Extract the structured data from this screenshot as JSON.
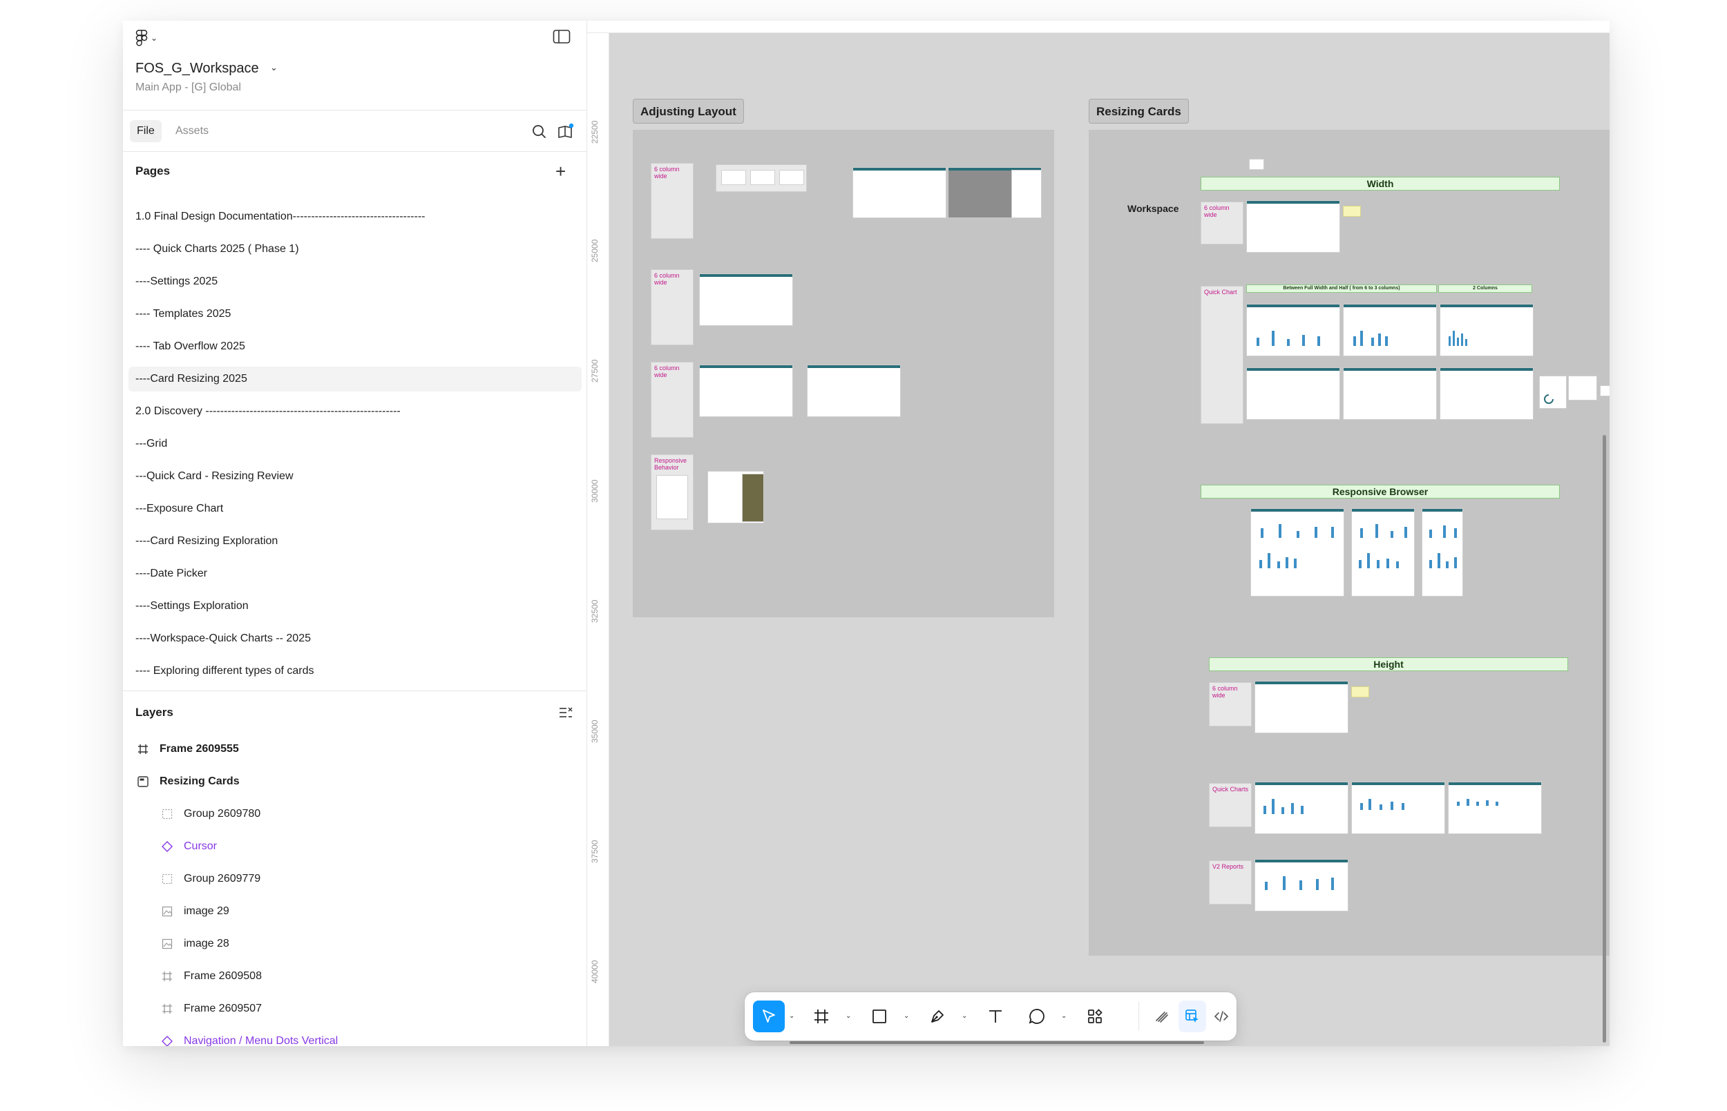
{
  "app": {
    "file_name": "FOS_G_Workspace",
    "file_subtitle": "Main App - [G] Global"
  },
  "tabs": {
    "file": "File",
    "assets": "Assets"
  },
  "pages": {
    "title": "Pages",
    "items": [
      "1.0 Final Design Documentation------------------------------------",
      "---- Quick Charts 2025 ( Phase 1)",
      "----Settings  2025",
      "---- Templates 2025",
      "---- Tab Overflow 2025",
      "----Card Resizing 2025",
      "2.0 Discovery -----------------------------------------------------",
      "---Grid",
      "---Quick Card - Resizing Review",
      "---Exposure Chart",
      "----Card Resizing Exploration",
      "----Date Picker",
      "----Settings Exploration",
      "----Workspace-Quick Charts -- 2025",
      "---- Exploring different types of cards"
    ],
    "selected_index": 5
  },
  "layers": {
    "title": "Layers",
    "items": [
      {
        "name": "Frame 2609555",
        "icon": "frame-icon",
        "indent": 0,
        "style": "bold"
      },
      {
        "name": "Resizing Cards",
        "icon": "section-icon",
        "indent": 0,
        "style": "bold"
      },
      {
        "name": "Group 2609780",
        "icon": "group-icon",
        "indent": 1,
        "style": "normal"
      },
      {
        "name": "Cursor",
        "icon": "component-icon",
        "indent": 1,
        "style": "purple"
      },
      {
        "name": "Group 2609779",
        "icon": "group-icon",
        "indent": 1,
        "style": "normal"
      },
      {
        "name": "image 29",
        "icon": "image-icon",
        "indent": 1,
        "style": "normal"
      },
      {
        "name": "image 28",
        "icon": "image-icon",
        "indent": 1,
        "style": "normal"
      },
      {
        "name": "Frame 2609508",
        "icon": "frame-icon",
        "indent": 1,
        "style": "normal"
      },
      {
        "name": "Frame 2609507",
        "icon": "frame-icon",
        "indent": 1,
        "style": "normal"
      },
      {
        "name": "Navigation / Menu Dots Vertical",
        "icon": "component-icon",
        "indent": 1,
        "style": "purple"
      }
    ]
  },
  "ruler": {
    "labels": [
      "22500",
      "25000",
      "27500",
      "30000",
      "32500",
      "35000",
      "37500",
      "40000"
    ]
  },
  "canvas": {
    "sections": {
      "adjusting_layout": "Adjusting Layout",
      "resizing_cards": "Resizing Cards"
    },
    "tags": {
      "six_column_wide": "6 column wide",
      "responsive_behavior": "Responsive Behavior",
      "quick_chart": "Quick Chart",
      "quick_charts": "Quick Charts",
      "v2_reports": "V2 Reports"
    },
    "workspace_label": "Workspace",
    "bands": {
      "width": "Width",
      "between": "Between Full Width and Half ( from 6 to 3 columns)",
      "two_columns": "2 Columns",
      "responsive_browser": "Responsive Browser",
      "height": "Height"
    }
  },
  "colors": {
    "accent": "#0d99ff",
    "component_purple": "#8638e5",
    "canvas_bg": "#d6d6d6",
    "band_green": "#e3f8de",
    "tag_pink": "#c2188a"
  }
}
